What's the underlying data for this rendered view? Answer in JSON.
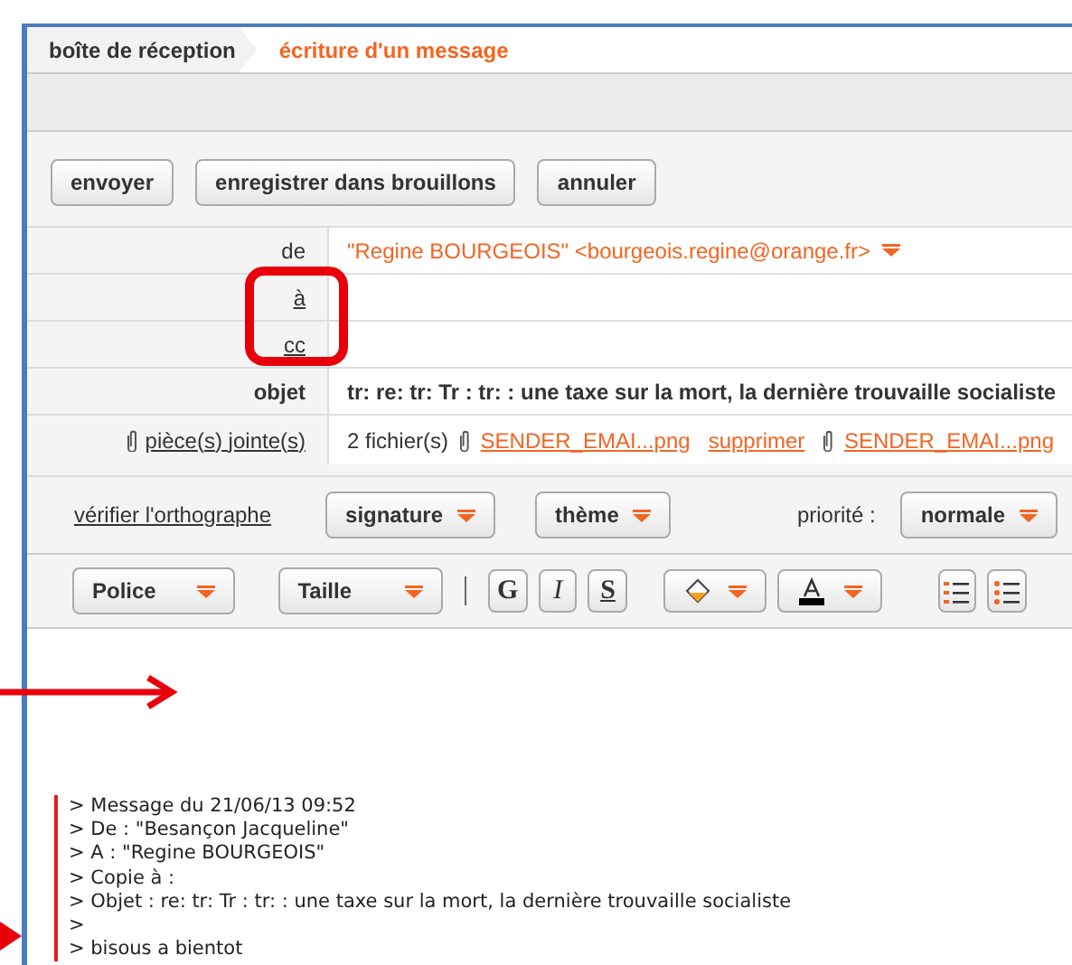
{
  "tabs": [
    {
      "label": "boîte de réception",
      "selected": false
    },
    {
      "label": "écriture d'un message",
      "selected": true
    }
  ],
  "actions": [
    "envoyer",
    "enregistrer dans brouillons",
    "annuler"
  ],
  "fields": [
    {
      "kind": "from",
      "label": "de",
      "value": "\"Regine BOURGEOIS\" <bourgeois.regine@orange.fr>"
    },
    {
      "kind": "link",
      "label": "à"
    },
    {
      "kind": "link",
      "label": "cc"
    },
    {
      "kind": "subject",
      "label": "objet",
      "value": "tr: re: tr: Tr : tr: : une taxe sur la mort, la dernière trouvaille socialiste"
    }
  ],
  "attachments": {
    "label": "pièce(s) jointe(s)",
    "count": "2 fichier(s)",
    "items": [
      {
        "kind": "file",
        "text": "SENDER_EMAI...png"
      },
      {
        "kind": "remove",
        "text": "supprimer"
      },
      {
        "kind": "file",
        "text": "SENDER_EMAI...png"
      }
    ]
  },
  "options": {
    "spellcheck": "vérifier l'orthographe",
    "menus": [
      "signature",
      "thème"
    ],
    "priority_label": "priorité :",
    "priority": "normale"
  },
  "toolbar": {
    "font": "Police",
    "size": "Taille",
    "styles": [
      {
        "kind": "bold",
        "text": "G"
      },
      {
        "kind": "italic",
        "text": "I"
      },
      {
        "kind": "underline",
        "text": "S"
      }
    ]
  },
  "quote": [
    "> Message du 21/06/13 09:52",
    "> De : \"Besançon Jacqueline\"",
    "> A : \"Regine BOURGEOIS\"",
    "> Copie à :",
    "> Objet : re: tr: Tr : tr: : une taxe sur la mort, la dernière trouvaille socialiste",
    ">",
    "> bisous a bientot"
  ]
}
